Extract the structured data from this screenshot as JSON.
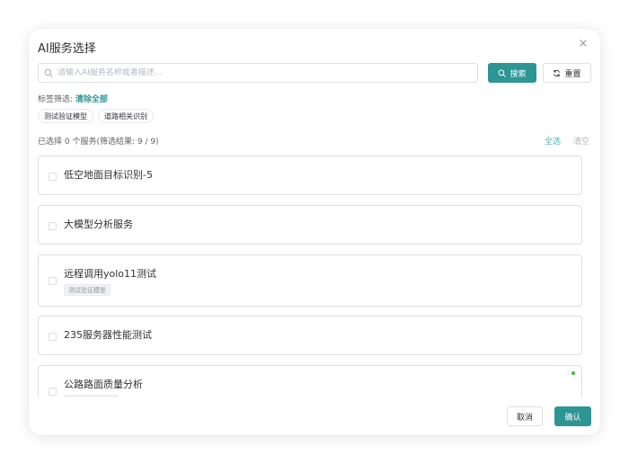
{
  "dialog": {
    "title": "AI服务选择",
    "close_icon": "close-icon"
  },
  "search": {
    "placeholder": "请输入AI服务名称或者描述...",
    "value": "",
    "search_label": "搜索",
    "reset_label": "重置"
  },
  "tags": {
    "label": "标签筛选:",
    "clear_all": "清除全部",
    "items": [
      "测试验证模型",
      "道路相关识别"
    ]
  },
  "summary": {
    "text": "已选择 0 个服务(筛选结果: 9 / 9)",
    "select_all": "全选",
    "clear": "清空"
  },
  "services": [
    {
      "name": "低空地面目标识别-5",
      "tag": ""
    },
    {
      "name": "大模型分析服务",
      "tag": ""
    },
    {
      "name": "远程调用yolo11测试",
      "tag": "测试验证模型"
    },
    {
      "name": "235服务器性能测试",
      "tag": ""
    },
    {
      "name": "公路路面质量分析",
      "tag": ""
    }
  ],
  "footer": {
    "cancel_label": "取消",
    "confirm_label": "确认"
  },
  "colors": {
    "accent": "#2e9595",
    "status_online": "#3cc13b"
  }
}
